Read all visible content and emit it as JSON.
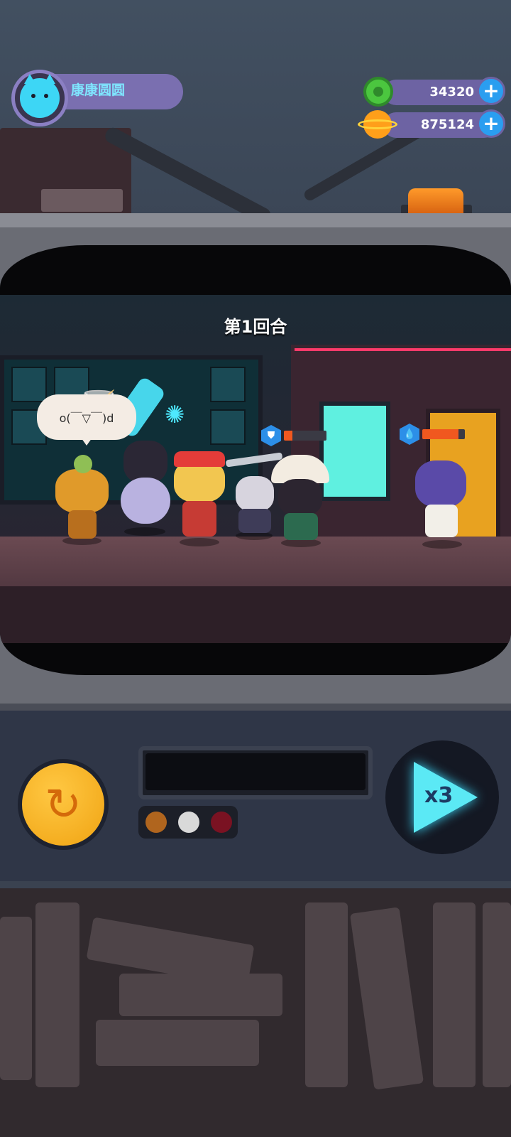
{
  "hud": {
    "player_name": "康康圆圆",
    "avatar": "cat-face-icon",
    "resources": [
      {
        "icon": "coin-icon",
        "value": "34320"
      },
      {
        "icon": "planet-icon",
        "value": "875124"
      }
    ],
    "plus_label": "+"
  },
  "battle": {
    "round_label": "第1回合",
    "emote_text": "o(￣▽￣)d",
    "enemies": [
      {
        "name": "enemy-pirate",
        "status_icon": "shield-icon",
        "hp_fraction": 0.2
      },
      {
        "name": "enemy-purple-hair",
        "status_icon": "drop-icon",
        "hp_fraction": 0.85
      }
    ]
  },
  "controls": {
    "reset_icon": "↻",
    "speed_label": "x3",
    "indicator_colors": [
      "#b0651e",
      "#d9d9d9",
      "#7a1222"
    ]
  },
  "colors": {
    "accent_cyan": "#4ee9ff",
    "hp_orange": "#f0581f",
    "reset_orange": "#f0a312"
  }
}
